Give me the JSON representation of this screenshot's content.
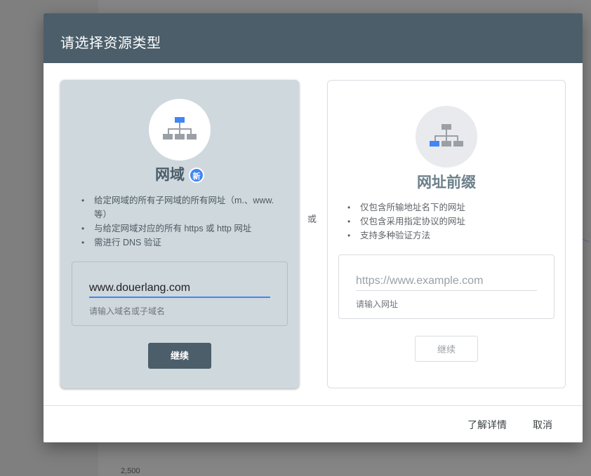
{
  "dialog": {
    "title": "请选择资源类型",
    "or_label": "或",
    "footer": {
      "learn_more": "了解详情",
      "cancel": "取消"
    }
  },
  "domain_card": {
    "title": "网域",
    "badge": "新",
    "bullets": [
      "给定网域的所有子网域的所有网址（m.、www. 等）",
      "与给定网域对应的所有 https 或 http 网址",
      "需进行 DNS 验证"
    ],
    "input_value": "www.douerlang.com",
    "helper": "请输入域名或子域名",
    "continue_label": "继续",
    "icon": "sitemap-icon"
  },
  "prefix_card": {
    "title": "网址前缀",
    "bullets": [
      "仅包含所输地址名下的网址",
      "仅包含采用指定协议的网址",
      "支持多种验证方法"
    ],
    "input_placeholder": "https://www.example.com",
    "helper": "请输入网址",
    "continue_label": "继续",
    "icon": "sitemap-icon"
  },
  "background": {
    "axis_tick": "2,500"
  },
  "colors": {
    "header_bg": "#4b5e6a",
    "selected_card_bg": "#cfd8dd",
    "accent_blue": "#4285f4"
  }
}
